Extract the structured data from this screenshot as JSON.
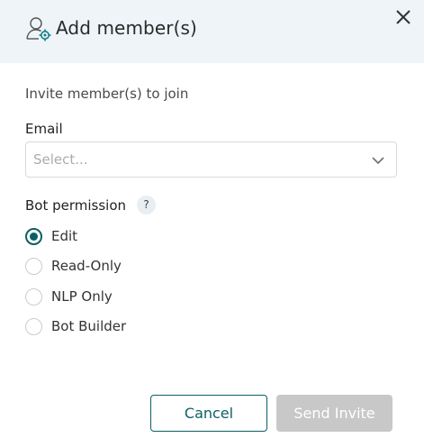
{
  "dialog": {
    "title": "Add member(s)",
    "subtitle": "Invite member(s) to join",
    "icons": {
      "header": "user-settings-icon",
      "close": "close-icon",
      "dropdown": "chevron-down-icon",
      "help": "help-icon"
    }
  },
  "email": {
    "label": "Email",
    "placeholder": "Select..."
  },
  "permission": {
    "label": "Bot permission",
    "help_glyph": "?",
    "selected": "Edit",
    "options": [
      {
        "label": "Edit",
        "checked": true
      },
      {
        "label": "Read-Only",
        "checked": false
      },
      {
        "label": "NLP Only",
        "checked": false
      },
      {
        "label": "Bot Builder",
        "checked": false
      }
    ]
  },
  "actions": {
    "cancel_label": "Cancel",
    "send_label": "Send Invite"
  },
  "colors": {
    "accent": "#0c5f63",
    "header_bg": "#eef4f8",
    "disabled_button": "#c8c8c8"
  }
}
